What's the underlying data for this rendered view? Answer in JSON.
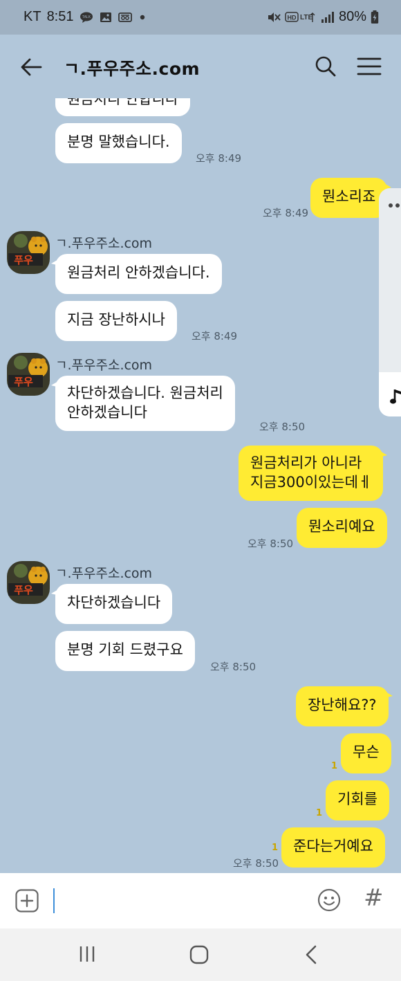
{
  "status_bar": {
    "carrier": "KT",
    "time": "8:51",
    "battery": "80%",
    "left_icons": [
      "kakaotalk-notification-icon",
      "gallery-notification-icon",
      "voicemail-notification-icon",
      "dot-icon"
    ],
    "right_icons": [
      "mute-icon",
      "hd-lte-icon",
      "signal-icon",
      "battery-charging-icon"
    ]
  },
  "app_bar": {
    "title": "ㄱ.푸우주소.com"
  },
  "messages": {
    "partial_top": "원금처리 안합니다",
    "m1": {
      "text": "분명 말했습니다.",
      "time": "오후 8:49"
    },
    "m2": {
      "text": "뭔소리죠",
      "time": "오후 8:49"
    },
    "g1": {
      "sender": "ㄱ.푸우주소.com",
      "m1": "원금처리 안하겠습니다.",
      "m2": "지금 장난하시나",
      "time": "오후 8:49"
    },
    "g2": {
      "sender": "ㄱ.푸우주소.com",
      "line1": "차단하겠습니다. 원금처리",
      "line2": "안하겠습니다",
      "time": "오후 8:50"
    },
    "o1": {
      "line1": "원금처리가 아니라",
      "line2": "지금300이있는데ㅔ"
    },
    "o2": {
      "text": "뭔소리예요",
      "time": "오후 8:50"
    },
    "g3": {
      "sender": "ㄱ.푸우주소.com",
      "m1": "차단하겠습니다",
      "m2": "분명 기회 드렸구요",
      "time": "오후 8:50"
    },
    "o3": {
      "text": "장난해요??"
    },
    "o4": {
      "text": "무슨",
      "unread": "1"
    },
    "o5": {
      "text": "기회를",
      "unread": "1"
    },
    "o6": {
      "text": "준다는거예요",
      "unread": "1",
      "time": "오후 8:50"
    }
  },
  "avatar": {
    "label": "푸우"
  },
  "input_bar": {
    "placeholder": "",
    "hash": "#"
  },
  "colors": {
    "background": "#b2c7da",
    "my_bubble": "#ffeb33",
    "their_bubble": "#ffffff",
    "status_bar": "#9fb1c2"
  }
}
